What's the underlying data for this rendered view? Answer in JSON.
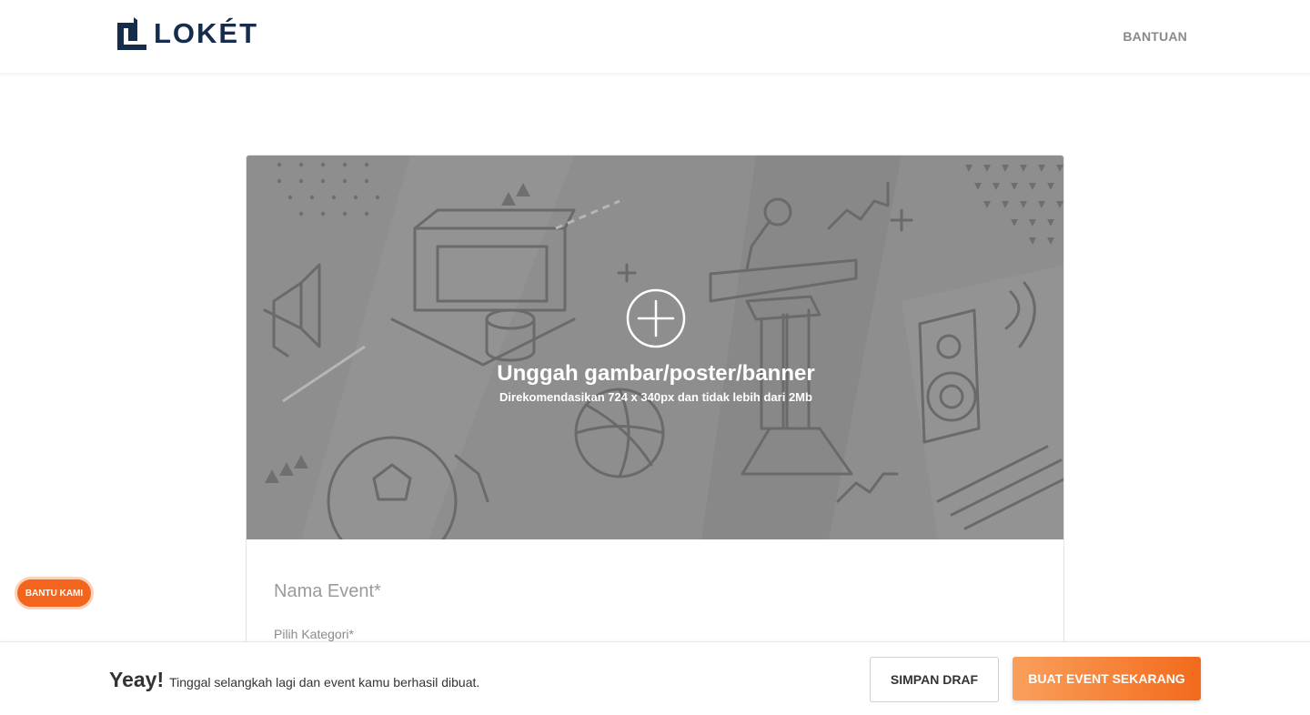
{
  "header": {
    "logo_text": "LOKÉT",
    "help_link": "BANTUAN"
  },
  "banner": {
    "title": "Unggah gambar/poster/banner",
    "subtitle": "Direkomendasikan 724 x 340px dan tidak lebih dari 2Mb"
  },
  "form": {
    "event_name_placeholder": "Nama Event*",
    "category_label": "Pilih Kategori*"
  },
  "help_button": {
    "label": "BANTU KAMI"
  },
  "footer": {
    "headline": "Yeay!",
    "message": "Tinggal selangkah lagi dan event kamu berhasil dibuat.",
    "draft_button": "SIMPAN DRAF",
    "create_button": "BUAT EVENT SEKARANG"
  },
  "colors": {
    "brand_navy": "#152c4d",
    "accent_orange": "#f36a1c",
    "banner_gray": "#8d8d8d"
  },
  "icons": {
    "logo": "loket-logo-icon",
    "upload": "plus-circle-icon"
  }
}
